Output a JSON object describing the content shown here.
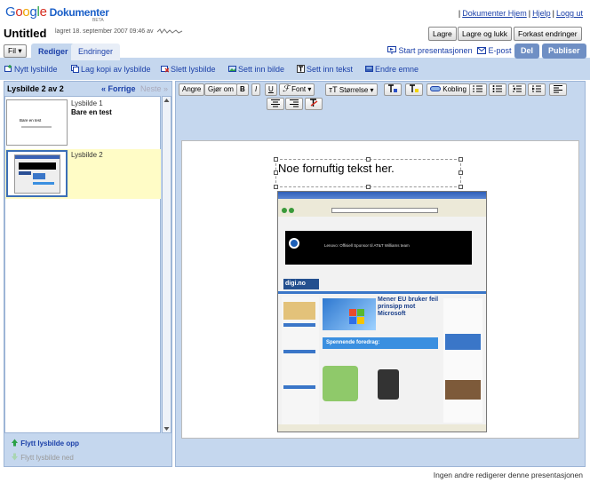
{
  "header": {
    "logo_letters": [
      "G",
      "o",
      "o",
      "g",
      "l",
      "e"
    ],
    "product": "Dokumenter",
    "beta": "BETA",
    "links": [
      "Dokumenter Hjem",
      "Hjelp",
      "Logg ut"
    ],
    "doc_title": "Untitled",
    "save_status": "lagret 18. september 2007 09:46 av",
    "buttons": {
      "save": "Lagre",
      "save_close": "Lagre og lukk",
      "discard": "Forkast endringer"
    }
  },
  "tabs": {
    "file": "Fil ▾",
    "edit": "Rediger",
    "changes": "Endringer",
    "start_presentation": "Start presentasjonen",
    "email": "E-post",
    "share": "Del",
    "publish": "Publiser"
  },
  "actions": [
    "Nytt lysbilde",
    "Lag kopi av lysbilde",
    "Slett lysbilde",
    "Sett inn bilde",
    "Sett inn tekst",
    "Endre emne"
  ],
  "left": {
    "title": "Lysbilde 2 av 2",
    "prev": "« Forrige",
    "next": "Neste »",
    "slides": [
      {
        "label": "Lysbilde 1",
        "subtitle": "Bare en test",
        "thumb_title": "Bare en test"
      },
      {
        "label": "Lysbilde 2",
        "subtitle": ""
      }
    ],
    "move_up": "Flytt lysbilde opp",
    "move_down": "Flytt lysbilde ned"
  },
  "toolbar": {
    "undo": "Angre",
    "redo": "Gjør om",
    "bold": "B",
    "italic": "I",
    "underline": "U",
    "font": "Font",
    "size": "Størrelse",
    "link": "Kobling"
  },
  "slide": {
    "text": "Noe fornuftig tekst her."
  },
  "embedded": {
    "site_logo": "digi.no",
    "banner": "Lenovo: Offisiell Sponsor til AT&T Williams team",
    "headline": "Mener EU bruker feil prinsipp mot Microsoft",
    "promo": "Spennende foredrag:"
  },
  "status": "Ingen andre redigerer denne presentasjonen",
  "colors": {
    "accent": "#c5d7ee",
    "link": "#1a3fa8",
    "selected_row": "#fffcc6"
  }
}
